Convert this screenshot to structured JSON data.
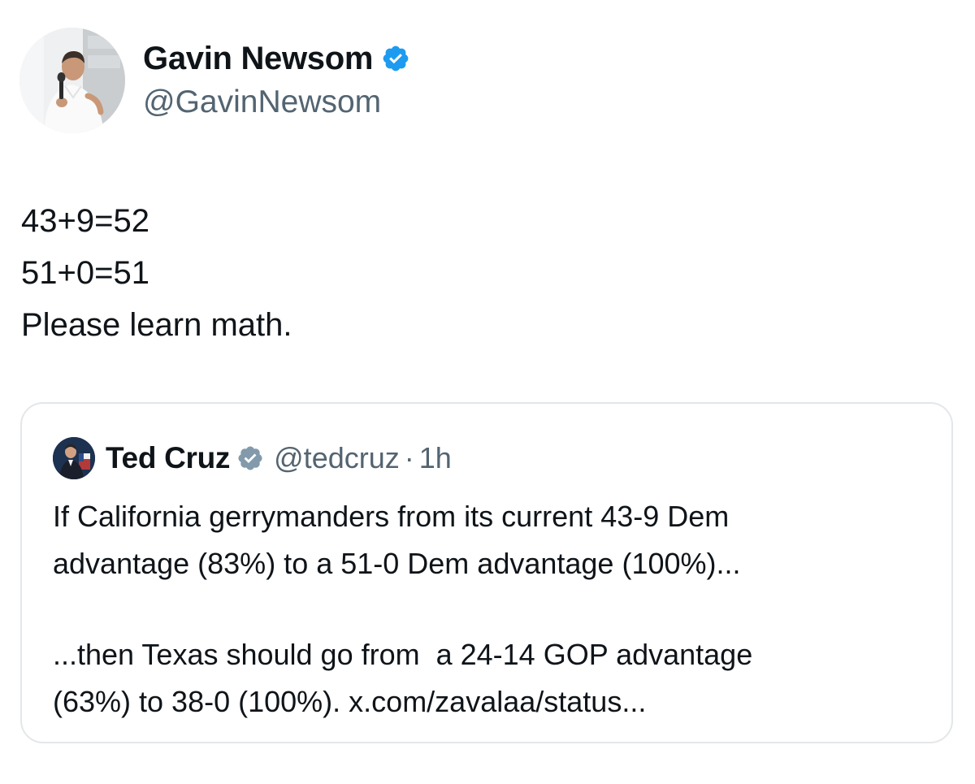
{
  "tweet": {
    "author_name": "Gavin Newsom",
    "author_handle": "@GavinNewsom",
    "verified_icon": "verified-badge-icon",
    "lines": [
      "43+9=52",
      "51+0=51",
      "Please learn math."
    ]
  },
  "quote": {
    "author_name": "Ted Cruz",
    "author_handle": "@tedcruz",
    "separator": "·",
    "time": "1h",
    "verified_icon": "verified-badge-icon",
    "paragraph1_lines": [
      "If California gerrymanders from its current 43-9 Dem",
      "advantage (83%) to a 51-0 Dem advantage (100%)..."
    ],
    "paragraph2_lines": [
      "...then Texas should go from  a 24-14 GOP advantage",
      "(63%) to 38-0 (100%). x.com/zavalaa/status..."
    ]
  },
  "colors": {
    "text": "#0f1419",
    "secondary_text": "#536471",
    "verified_main": "#1d9bf0",
    "verified_quote": "#829aab",
    "card_border": "#e3e7ea"
  }
}
